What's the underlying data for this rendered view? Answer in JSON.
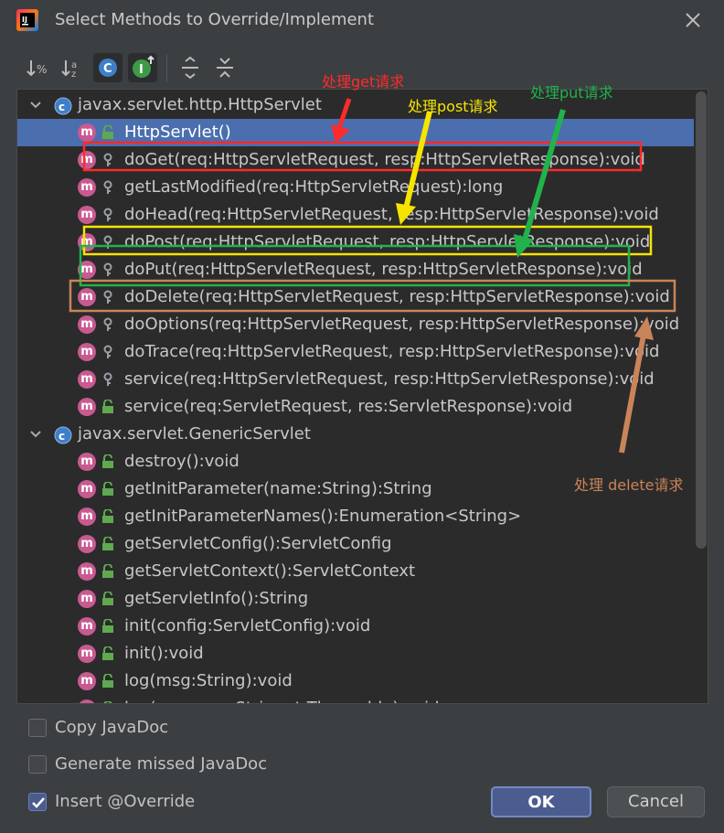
{
  "window": {
    "title": "Select Methods to Override/Implement",
    "logo_text": "IJ"
  },
  "toolbar": {
    "buttons": [
      {
        "name": "sort-by-visibility",
        "icon": "sort-visibility-icon",
        "glyph": "↓%"
      },
      {
        "name": "sort-alphabetically",
        "icon": "sort-alpha-icon",
        "glyph": "↓ᵃz"
      },
      {
        "name": "show-classes",
        "icon": "class-icon",
        "glyph": "C",
        "active": true
      },
      {
        "name": "show-interfaces",
        "icon": "interface-icon",
        "glyph": "I",
        "active": true
      },
      {
        "name": "expand-all",
        "icon": "expand-all-icon"
      },
      {
        "name": "collapse-all",
        "icon": "collapse-all-icon"
      }
    ]
  },
  "tree": {
    "groups": [
      {
        "class_name": "javax.servlet.http.HttpServlet",
        "methods": [
          {
            "label": "HttpServlet()",
            "visibility": "public",
            "selected": true
          },
          {
            "label": "doGet(req:HttpServletRequest, resp:HttpServletResponse):void",
            "visibility": "protected"
          },
          {
            "label": "getLastModified(req:HttpServletRequest):long",
            "visibility": "protected"
          },
          {
            "label": "doHead(req:HttpServletRequest, resp:HttpServletResponse):void",
            "visibility": "protected"
          },
          {
            "label": "doPost(req:HttpServletRequest, resp:HttpServletResponse):void",
            "visibility": "protected"
          },
          {
            "label": "doPut(req:HttpServletRequest, resp:HttpServletResponse):void",
            "visibility": "protected"
          },
          {
            "label": "doDelete(req:HttpServletRequest, resp:HttpServletResponse):void",
            "visibility": "protected"
          },
          {
            "label": "doOptions(req:HttpServletRequest, resp:HttpServletResponse):void",
            "visibility": "protected"
          },
          {
            "label": "doTrace(req:HttpServletRequest, resp:HttpServletResponse):void",
            "visibility": "protected"
          },
          {
            "label": "service(req:HttpServletRequest, resp:HttpServletResponse):void",
            "visibility": "protected"
          },
          {
            "label": "service(req:ServletRequest, res:ServletResponse):void",
            "visibility": "public"
          }
        ]
      },
      {
        "class_name": "javax.servlet.GenericServlet",
        "methods": [
          {
            "label": "destroy():void",
            "visibility": "public"
          },
          {
            "label": "getInitParameter(name:String):String",
            "visibility": "public"
          },
          {
            "label": "getInitParameterNames():Enumeration<String>",
            "visibility": "public"
          },
          {
            "label": "getServletConfig():ServletConfig",
            "visibility": "public"
          },
          {
            "label": "getServletContext():ServletContext",
            "visibility": "public"
          },
          {
            "label": "getServletInfo():String",
            "visibility": "public"
          },
          {
            "label": "init(config:ServletConfig):void",
            "visibility": "public"
          },
          {
            "label": "init():void",
            "visibility": "public"
          },
          {
            "label": "log(msg:String):void",
            "visibility": "public"
          },
          {
            "label": "log(message:String, t:Throwable):void",
            "visibility": "public"
          }
        ]
      }
    ],
    "method_icon_letter": "m"
  },
  "annotations": [
    {
      "text": "处理get请求",
      "color": "#ff2a2a"
    },
    {
      "text": "处理post请求",
      "color": "#f5e400"
    },
    {
      "text": "处理put请求",
      "color": "#22b24c"
    },
    {
      "text": "处理 delete请求",
      "color": "#c98459"
    }
  ],
  "options": [
    {
      "label": "Copy JavaDoc",
      "checked": false
    },
    {
      "label": "Generate missed JavaDoc",
      "checked": false
    },
    {
      "label": "Insert @Override",
      "checked": true
    }
  ],
  "buttons": {
    "ok": "OK",
    "cancel": "Cancel"
  },
  "colors": {
    "background": "#3c3f41",
    "tree_background": "#2b2b2b",
    "selection": "#4b6eaf",
    "method_icon": "#c75a91",
    "public_lock": "#5faa50",
    "protected_key": "#9aa0a6"
  }
}
